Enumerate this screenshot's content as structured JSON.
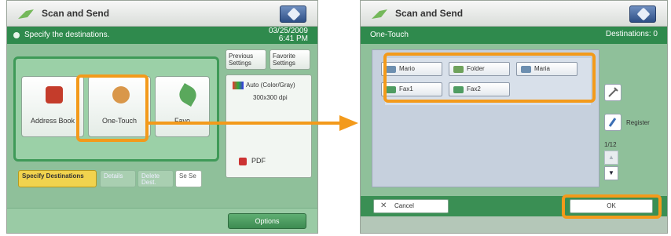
{
  "left_screen": {
    "title": "Scan and Send",
    "banner_text": "Specify the destinations.",
    "date": "03/25/2009",
    "time": "6:41 PM",
    "function_buttons": [
      {
        "label": "Address Book"
      },
      {
        "label": "One-Touch"
      },
      {
        "label": "Favo"
      }
    ],
    "tabs": {
      "specify": "Specify Destinations",
      "details": "Details",
      "delete": "Delete Dest.",
      "sendto": "Se Se"
    },
    "previous_settings": "Previous Settings",
    "favorite_settings": "Favorite Settings",
    "color_mode": "Auto (Color/Gray)",
    "resolution": "300x300 dpi",
    "file_format": "PDF",
    "options_button": "Options"
  },
  "right_screen": {
    "title": "Scan and Send",
    "banner_text": "One-Touch",
    "destinations_label": "Destinations: 0",
    "destination_buttons": [
      {
        "id": "mail1",
        "label": "Mario",
        "icon": "mail-icon"
      },
      {
        "id": "folder1",
        "label": "Folder",
        "icon": "folder-icon"
      },
      {
        "id": "mail2",
        "label": "Maria",
        "icon": "mail-icon"
      },
      {
        "id": "fax1",
        "label": "Fax1",
        "icon": "fax-icon"
      },
      {
        "id": "fax2",
        "label": "Fax2",
        "icon": "fax-icon"
      }
    ],
    "register_label": "Register",
    "page_indicator": "1/12",
    "cancel_label": "Cancel",
    "ok_label": "OK"
  },
  "colors": {
    "highlight": "#f39a1b",
    "green_bar": "#2f8a4d",
    "accent_yellow": "#f1d34e"
  }
}
